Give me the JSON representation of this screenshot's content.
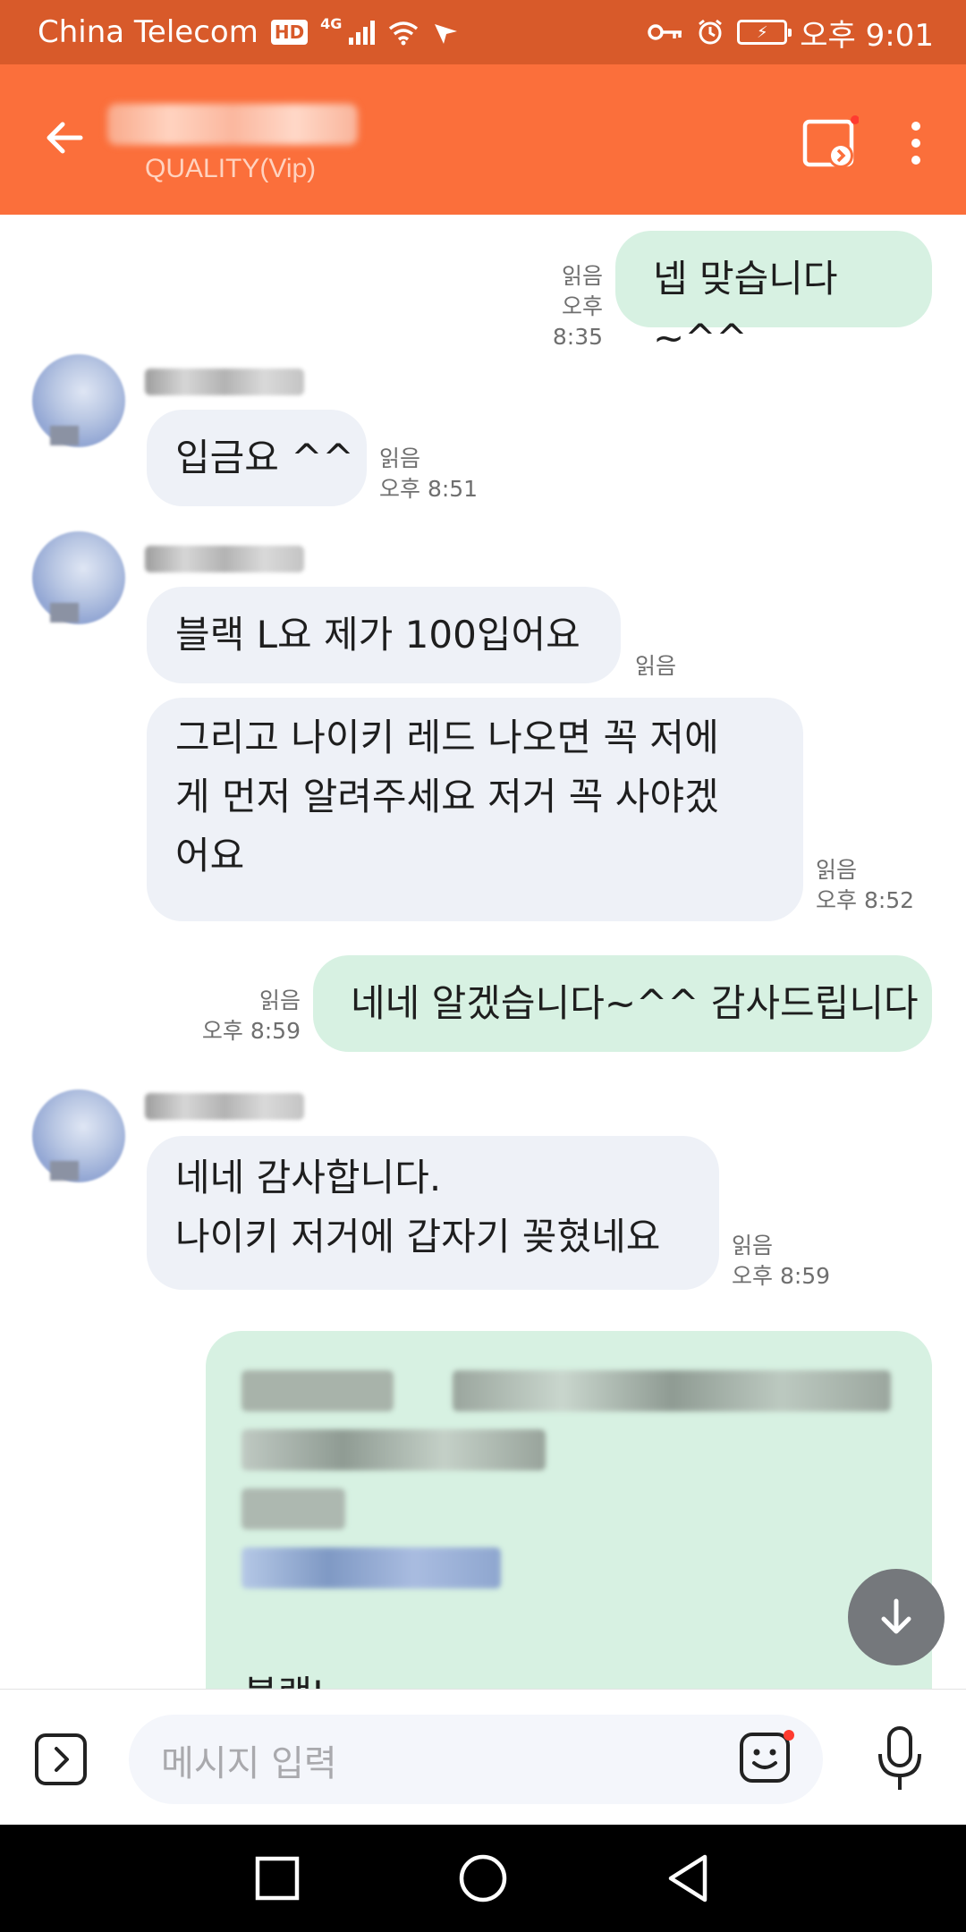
{
  "status_bar": {
    "carrier": "China Telecom",
    "hd_label": "HD",
    "network": "4G",
    "time": "오후 9:01"
  },
  "header": {
    "subtitle": "QUALITY(Vip)"
  },
  "messages": [
    {
      "side": "out",
      "text": "넵 맞습니다~^^",
      "read": "읽음",
      "time": "오후 8:35"
    },
    {
      "side": "in",
      "text": "입금요 ^^",
      "read": "읽음",
      "time": "오후 8:51"
    },
    {
      "side": "in",
      "text": "블랙 L요 제가 100입어요",
      "read": "읽음",
      "time": ""
    },
    {
      "side": "in",
      "lines": [
        "그리고 나이키 레드 나오면 꼭 저에",
        "게 먼저 알려주세요 저거 꼭 사야겠",
        "어요"
      ],
      "read": "읽음",
      "time": "오후 8:52"
    },
    {
      "side": "out",
      "text": "네네 알겠습니다~^^ 감사드립니다",
      "read": "읽음",
      "time": "오후 8:59"
    },
    {
      "side": "in",
      "lines": [
        "네네 감사합니다.",
        "나이키 저거에 갑자기 꽂혔네요"
      ],
      "read": "읽음",
      "time": "오후 8:59"
    },
    {
      "side": "out",
      "lines": [
        "블랙L"
      ],
      "read": "",
      "time": ""
    }
  ],
  "input": {
    "placeholder": "메시지 입력"
  },
  "icons": {
    "back": "arrow-left-icon",
    "share": "screen-share-icon",
    "more": "more-vertical-icon",
    "scroll": "arrow-down-icon",
    "expand": "chevron-right-icon",
    "emoji": "emoji-icon",
    "mic": "microphone-icon"
  },
  "colors": {
    "status_bar": "#d85a2a",
    "app_bar": "#fb6f3b",
    "incoming_bubble": "#eef1f7",
    "outgoing_bubble": "#d7f1e2",
    "notification_dot": "#ff3b30"
  }
}
